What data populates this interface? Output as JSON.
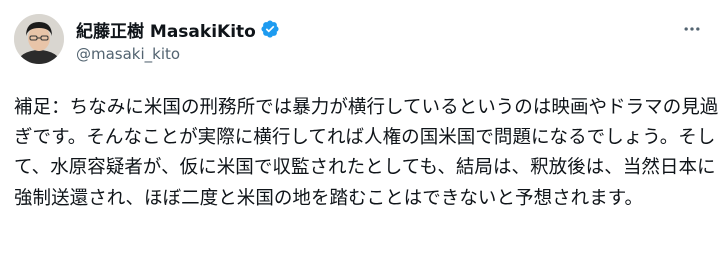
{
  "author": {
    "display_name": "紀藤正樹 MasakiKito",
    "handle": "@masaki_kito",
    "verified": true
  },
  "tweet": {
    "text": "補足：ちなみに米国の刑務所では暴力が横行しているというのは映画やドラマの見過ぎです。そんなことが実際に横行してれば人権の国米国で問題になるでしょう。そして、水原容疑者が、仮に米国で収監されたとしても、結局は、釈放後は、当然日本に強制送還され、ほぼ二度と米国の地を踏むことはできないと予想されます。"
  },
  "icons": {
    "avatar": "avatar-photo",
    "verified": "verified-badge-icon",
    "more": "more-options-icon"
  },
  "colors": {
    "text": "#0f1419",
    "secondary_text": "#536471",
    "verified_blue": "#1d9bf0",
    "background": "#ffffff"
  }
}
